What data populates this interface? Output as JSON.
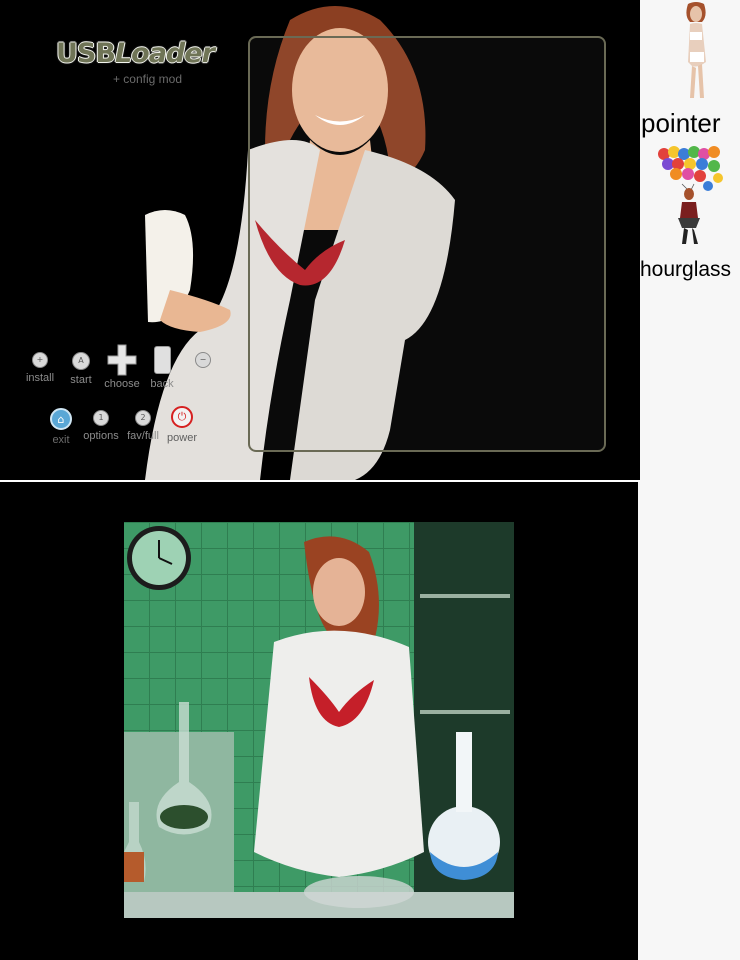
{
  "app": {
    "logo_text_main": "USB",
    "logo_text_italic": "Loader",
    "logo_subtitle": "+ config mod"
  },
  "controls_row1": [
    {
      "id": "install",
      "label": "install",
      "icon": "plus-button-icon",
      "glyph": "+"
    },
    {
      "id": "start",
      "label": "start",
      "icon": "a-button-icon",
      "glyph": "A"
    },
    {
      "id": "choose",
      "label": "choose",
      "icon": "dpad-icon",
      "glyph": ""
    },
    {
      "id": "back",
      "label": "back",
      "icon": "b-button-icon",
      "glyph": ""
    },
    {
      "id": "minus",
      "label": "",
      "icon": "minus-button-icon",
      "glyph": "−"
    }
  ],
  "controls_row2": [
    {
      "id": "exit",
      "label": "exit",
      "icon": "home-button-icon",
      "glyph": "⌂"
    },
    {
      "id": "options",
      "label": "options",
      "icon": "one-button-icon",
      "glyph": "1"
    },
    {
      "id": "favfull",
      "label": "fav/full",
      "icon": "two-button-icon",
      "glyph": "2"
    },
    {
      "id": "power",
      "label": "power",
      "icon": "power-button-icon",
      "glyph": "⏻"
    }
  ],
  "sidebar": {
    "pointer_label": "pointer",
    "hourglass_label": "hourglass"
  },
  "colors": {
    "background": "#000000",
    "sidebar_bg": "#f7f7f7",
    "frame_border": "#6a6a55",
    "label_gray": "#8c8c8c",
    "power_red": "#d62020"
  }
}
